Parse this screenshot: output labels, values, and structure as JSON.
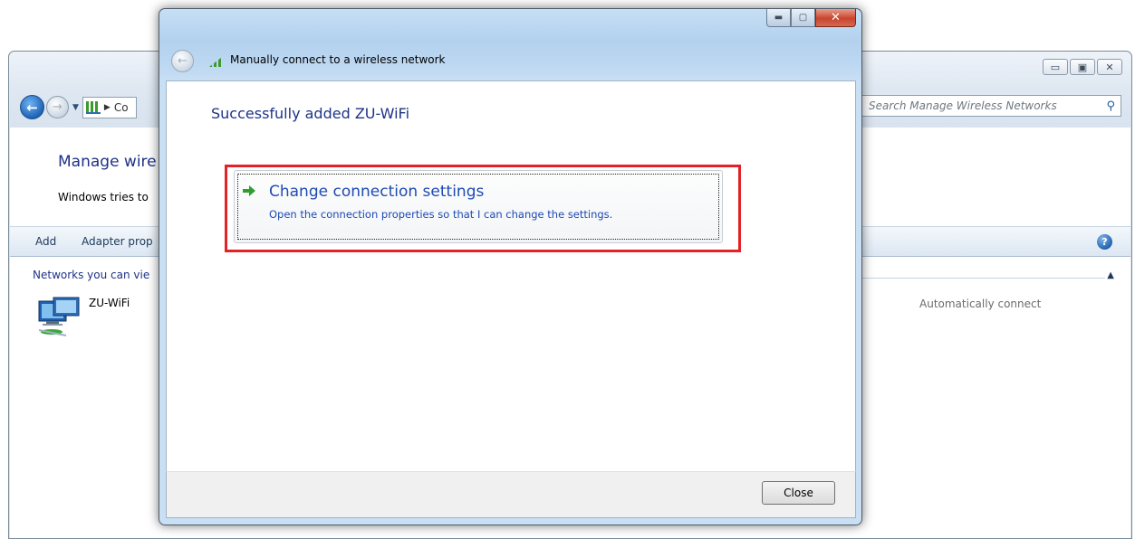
{
  "background_window": {
    "address_text": "Co",
    "search_placeholder": "Search Manage Wireless Networks",
    "title": "Manage wire",
    "description": "Windows tries to",
    "toolbar": {
      "add_label": "Add",
      "adapter_label": "Adapter prop"
    },
    "group_header": "Networks you can vie",
    "network": {
      "name": "ZU-WiFi",
      "mode": "Automatically connect"
    }
  },
  "dialog": {
    "title": "Manually connect to a wireless network",
    "heading": "Successfully added ZU-WiFi",
    "link": {
      "title": "Change connection settings",
      "subtitle": "Open the connection properties so that I can change the settings."
    },
    "close_label": "Close"
  },
  "colors": {
    "heading_blue": "#1e3287",
    "link_blue": "#1e4ab4",
    "highlight_red": "#e32227",
    "signal_green": "#3b9b2f"
  }
}
